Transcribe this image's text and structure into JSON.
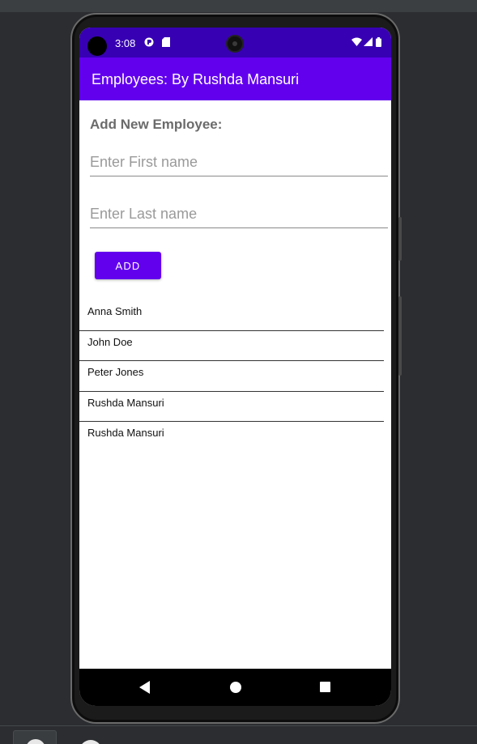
{
  "status_bar": {
    "time": "3:08",
    "left_icons": [
      "android-icon",
      "sd-card-icon"
    ],
    "right_icons": [
      "wifi-icon",
      "signal-icon",
      "battery-icon"
    ]
  },
  "app_bar": {
    "title": "Employees: By Rushda Mansuri"
  },
  "form": {
    "heading": "Add New Employee:",
    "first_name": {
      "value": "",
      "placeholder": "Enter First name"
    },
    "last_name": {
      "value": "",
      "placeholder": "Enter Last name"
    },
    "add_button_label": "ADD"
  },
  "employees": [
    {
      "name": "Anna Smith"
    },
    {
      "name": "John Doe"
    },
    {
      "name": "Peter Jones"
    },
    {
      "name": "Rushda Mansuri"
    },
    {
      "name": "Rushda Mansuri"
    }
  ],
  "nav_bar": {
    "buttons": [
      "back-icon",
      "home-icon",
      "recents-icon"
    ]
  },
  "colors": {
    "status_bar": "#3700b3",
    "primary": "#6200ee",
    "background": "#ffffff"
  }
}
